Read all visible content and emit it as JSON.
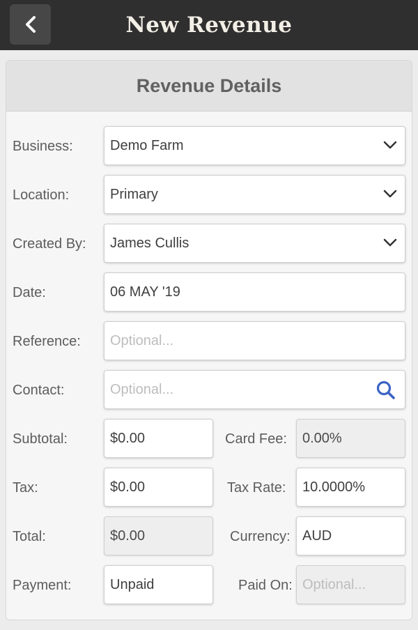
{
  "header": {
    "title": "New Revenue",
    "back_icon": "chevron-left-icon"
  },
  "card": {
    "title": "Revenue Details"
  },
  "form": {
    "business": {
      "label": "Business:",
      "value": "Demo Farm"
    },
    "location": {
      "label": "Location:",
      "value": "Primary"
    },
    "created_by": {
      "label": "Created By:",
      "value": "James Cullis"
    },
    "date": {
      "label": "Date:",
      "value": "06 MAY '19"
    },
    "reference": {
      "label": "Reference:",
      "placeholder": "Optional..."
    },
    "contact": {
      "label": "Contact:",
      "placeholder": "Optional...",
      "icon": "search-icon"
    },
    "subtotal": {
      "label": "Subtotal:",
      "value": "$0.00"
    },
    "card_fee": {
      "label": "Card Fee:",
      "value": "0.00%"
    },
    "tax": {
      "label": "Tax:",
      "value": "$0.00"
    },
    "tax_rate": {
      "label": "Tax Rate:",
      "value": "10.0000%"
    },
    "total": {
      "label": "Total:",
      "value": "$0.00"
    },
    "currency": {
      "label": "Currency:",
      "value": "AUD"
    },
    "payment": {
      "label": "Payment:",
      "value": "Unpaid"
    },
    "paid_on": {
      "label": "Paid On:",
      "placeholder": "Optional..."
    }
  },
  "colors": {
    "topbar": "#2f2f2f",
    "search_icon": "#3b63c4"
  }
}
